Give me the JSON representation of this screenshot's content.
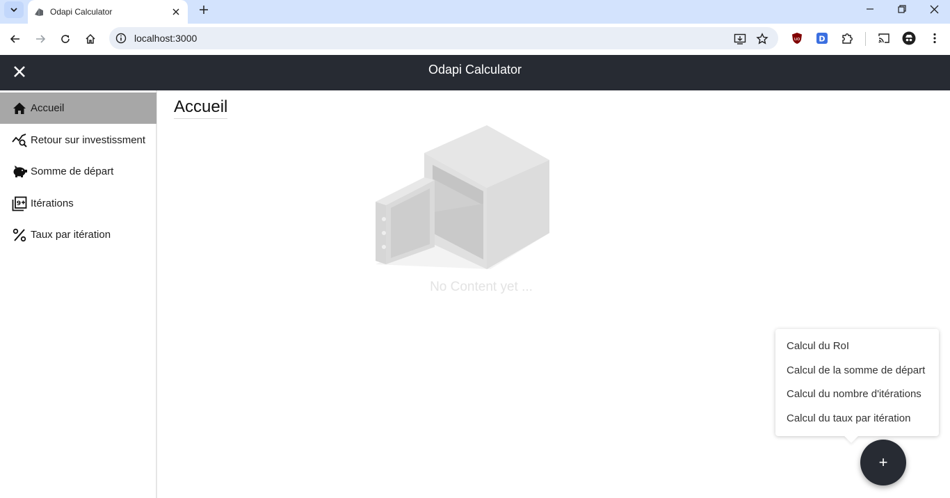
{
  "browser": {
    "tab_title": "Odapi Calculator",
    "url": "localhost:3000"
  },
  "app": {
    "title": "Odapi Calculator",
    "header_bg": "#272b33"
  },
  "sidebar": {
    "items": [
      {
        "label": "Accueil",
        "icon": "home-icon",
        "active": true
      },
      {
        "label": "Retour sur investissment",
        "icon": "chart-search-icon",
        "active": false
      },
      {
        "label": "Somme de départ",
        "icon": "piggy-bank-icon",
        "active": false
      },
      {
        "label": "Itérations",
        "icon": "filter-9-plus-icon",
        "active": false
      },
      {
        "label": "Taux par itération",
        "icon": "percent-icon",
        "active": false
      }
    ]
  },
  "main": {
    "title": "Accueil",
    "empty_text": "No Content yet ..."
  },
  "fab_menu": {
    "items": [
      {
        "label": "Calcul du RoI"
      },
      {
        "label": "Calcul de la somme de départ"
      },
      {
        "label": "Calcul du nombre d'itérations"
      },
      {
        "label": "Calcul du taux par itération"
      }
    ],
    "fab_label": "+"
  }
}
